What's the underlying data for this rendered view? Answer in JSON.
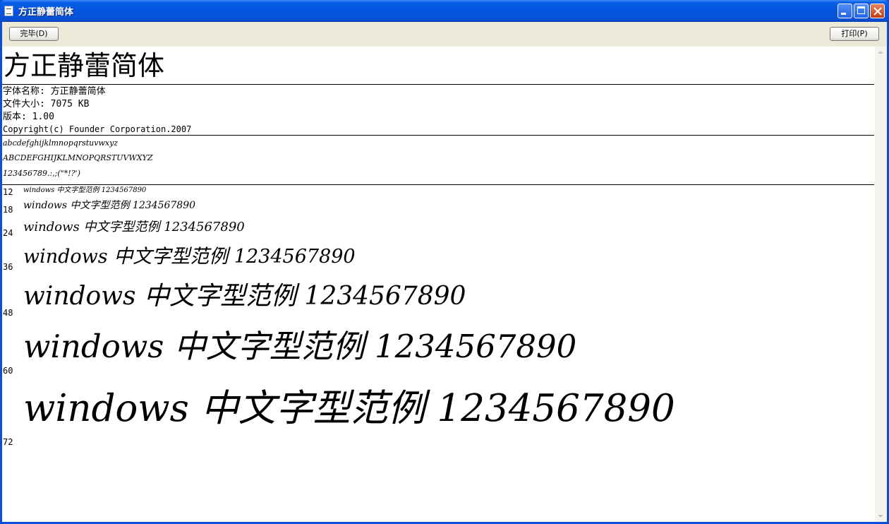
{
  "window": {
    "title": "方正静蕾简体",
    "icon": "font-file-icon"
  },
  "toolbar": {
    "done_label": "完毕(D)",
    "print_label": "打印(P)"
  },
  "font": {
    "display_name": "方正静蕾简体",
    "name_line": "字体名称: 方正静蕾简体",
    "size_line": "文件大小: 7075 KB",
    "version_line": "版本: 1.00",
    "copyright_line": "Copyright(c) Founder Corporation.2007"
  },
  "charset": {
    "lowercase": "abcdefghijklmnopqrstuvwxyz",
    "uppercase": "ABCDEFGHIJKLMNOPQRSTUVWXYZ",
    "digits_symbols": "123456789.:,;(\"*!?')"
  },
  "samples": [
    {
      "size": "12",
      "text": "windows 中文字型范例 1234567890"
    },
    {
      "size": "18",
      "text": "windows 中文字型范例 1234567890"
    },
    {
      "size": "24",
      "text": "windows 中文字型范例 1234567890"
    },
    {
      "size": "36",
      "text": "windows 中文字型范例 1234567890"
    },
    {
      "size": "48",
      "text": "windows 中文字型范例 1234567890"
    },
    {
      "size": "60",
      "text": "windows 中文字型范例 1234567890"
    },
    {
      "size": "72",
      "text": "windows 中文字型范例 1234567890"
    }
  ]
}
